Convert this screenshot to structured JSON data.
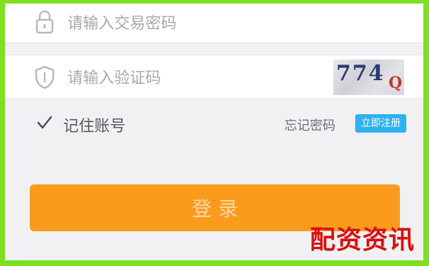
{
  "form": {
    "password": {
      "placeholder": "请输入交易密码",
      "icon": "lock-icon"
    },
    "captcha_input": {
      "placeholder": "请输入验证码",
      "icon": "shield-icon"
    },
    "captcha_image": {
      "main": "774",
      "tail": "Q"
    },
    "remember": {
      "label": "记住账号",
      "checked": true,
      "icon": "checkmark-icon"
    },
    "forgot_label": "忘记密码",
    "badge_label": "立即注册",
    "login_label": "登 录"
  },
  "watermark": "配资资讯",
  "colors": {
    "frame_border": "#7ee01e",
    "background": "#f1f1f3",
    "button": "#fb9b1e",
    "badge": "#2fb2f0",
    "watermark": "#d8100f"
  }
}
